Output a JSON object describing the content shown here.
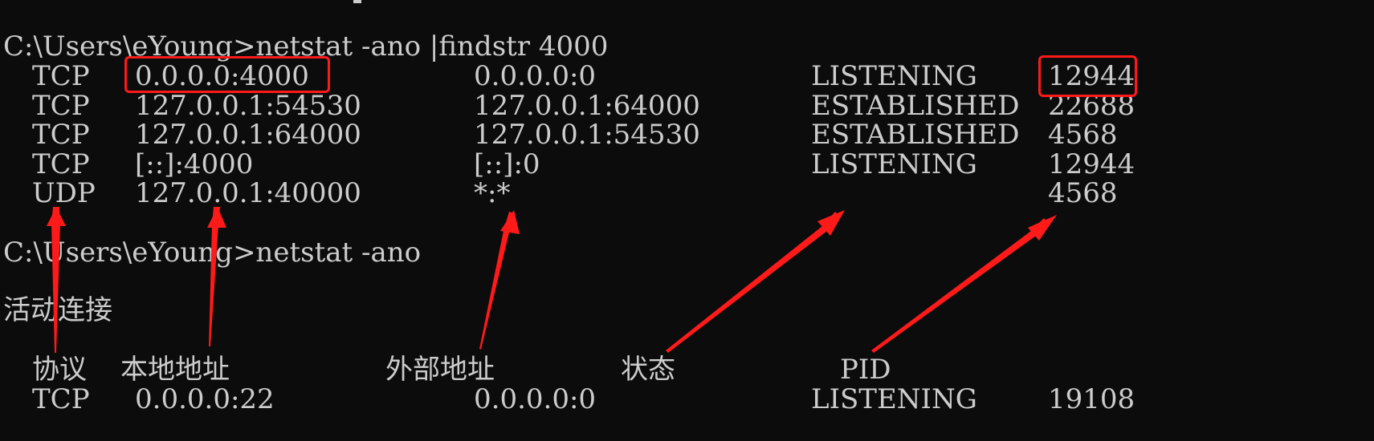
{
  "terminal": {
    "command1": "C:\\Users\\eYoung>netstat -ano |findstr 4000",
    "rows": [
      {
        "proto": "TCP",
        "local": "0.0.0.0:4000",
        "foreign": "0.0.0.0:0",
        "state": "LISTENING",
        "pid": "12944"
      },
      {
        "proto": "TCP",
        "local": "127.0.0.1:54530",
        "foreign": "127.0.0.1:64000",
        "state": "ESTABLISHED",
        "pid": "22688"
      },
      {
        "proto": "TCP",
        "local": "127.0.0.1:64000",
        "foreign": "127.0.0.1:54530",
        "state": "ESTABLISHED",
        "pid": "4568"
      },
      {
        "proto": "TCP",
        "local": "[::]:4000",
        "foreign": "[::]:0",
        "state": "LISTENING",
        "pid": "12944"
      },
      {
        "proto": "UDP",
        "local": "127.0.0.1:40000",
        "foreign": "*:*",
        "state": "",
        "pid": "4568"
      }
    ],
    "command2": "C:\\Users\\eYoung>netstat -ano",
    "section_title": "活动连接",
    "headers": {
      "proto": "协议",
      "local": "本地地址",
      "foreign": "外部地址",
      "state": "状态",
      "pid": "PID"
    },
    "partial_row": {
      "proto": "TCP",
      "local": "0.0.0.0:22",
      "foreign": "0.0.0.0:0",
      "state": "LISTENING",
      "pid": "19108"
    }
  },
  "colors": {
    "background": "#0c0c0c",
    "text": "#cccccc",
    "annotation": "#ff1a1a"
  }
}
